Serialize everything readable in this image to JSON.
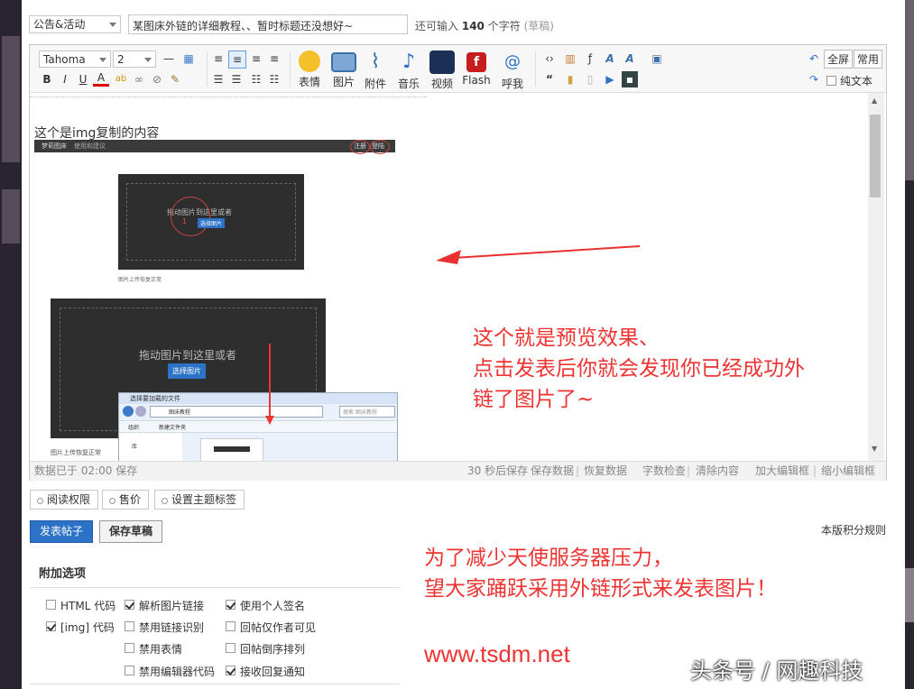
{
  "header": {
    "category": "公告&活动",
    "title_value": "某图床外链的详细教程、、暂时标题还没想好~",
    "counter_prefix": "还可输入",
    "counter_value": "140",
    "counter_suffix": "个字符",
    "draft_label": "(草稿)"
  },
  "toolbar": {
    "font_family": "Tahoma",
    "font_size": "2",
    "big_buttons": [
      {
        "label": "表情",
        "icon": "smiley-icon"
      },
      {
        "label": "图片",
        "icon": "image-icon"
      },
      {
        "label": "附件",
        "icon": "paperclip-icon"
      },
      {
        "label": "音乐",
        "icon": "music-icon"
      },
      {
        "label": "视频",
        "icon": "video-icon"
      },
      {
        "label": "Flash",
        "icon": "flash-icon"
      },
      {
        "label": "呼我",
        "icon": "at-icon"
      }
    ],
    "fullscreen_label": "全屏",
    "common_label": "常用",
    "plaintext_label": "纯文本"
  },
  "content": {
    "line1": "这个是img复制的内容",
    "shot1_top_left": "梦莉图床",
    "shot1_nav": "使用和建议",
    "shot1_right1": "注册",
    "shot1_right2": "登陆",
    "drop_text": "拖动图片到这里或者",
    "step_number": "1",
    "select_button": "选择图片",
    "caption1": "图片上传恢复正常",
    "drop_text2": "拖动图片到这里或者",
    "select_button2": "选择图片",
    "caption2": "图片上传恢复正常",
    "dialog_title": "选择要加载的文件",
    "dialog_path": "图床教程",
    "dialog_search": "搜索 图床教程",
    "dialog_org": "组织",
    "dialog_newfolder": "新建文件夹",
    "dialog_lib": "库"
  },
  "status": {
    "saved": "数据已于 02:00 保存",
    "links": [
      "30 秒后保存",
      "保存数据",
      "恢复数据",
      "字数检查",
      "清除内容",
      "加大编辑框",
      "缩小编辑框"
    ]
  },
  "tabs": [
    "阅读权限",
    "售价",
    "设置主题标签"
  ],
  "actions": {
    "publish": "发表帖子",
    "save_draft": "保存草稿",
    "rules": "本版积分规则"
  },
  "options": {
    "heading": "附加选项",
    "items": [
      {
        "label": "HTML 代码",
        "checked": false
      },
      {
        "label": "解析图片链接",
        "checked": true
      },
      {
        "label": "使用个人签名",
        "checked": true
      },
      {
        "label": "[img] 代码",
        "checked": true
      },
      {
        "label": "禁用链接识别",
        "checked": false
      },
      {
        "label": "回帖仅作者可见",
        "checked": false
      },
      {
        "label": "禁用表情",
        "checked": false
      },
      {
        "label": "回帖倒序排列",
        "checked": false
      },
      {
        "label": "禁用编辑器代码",
        "checked": false
      },
      {
        "label": "接收回复通知",
        "checked": true
      }
    ]
  },
  "annotations": {
    "preview_line1": "这个就是预览效果、",
    "preview_line2": "点击发表后你就会发现你已经成功外",
    "preview_line3": "链了图片了~",
    "note_line1": "为了减少天使服务器压力，",
    "note_line2": "望大家踊跃采用外链形式来发表图片！",
    "site": "www.tsdm.net",
    "arrow_color": "#e83030"
  },
  "watermark": "头条号 / 网趣科技"
}
